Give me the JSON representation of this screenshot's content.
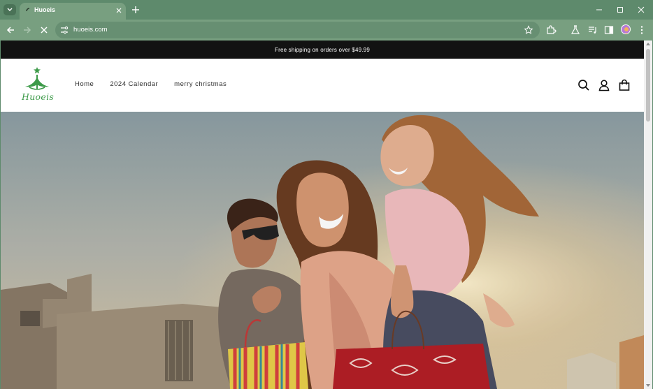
{
  "browser": {
    "tab_title": "Huoeis",
    "url": "huoeis.com",
    "frame_color": "#5e8a6c",
    "toolbar_color": "#789f80"
  },
  "site": {
    "announcement": "Free shipping on orders over $49.99",
    "logo_text": "Huoeis",
    "brand_color": "#3d9a49",
    "nav": [
      "Home",
      "2024 Calendar",
      "merry christmas"
    ]
  },
  "icons": {
    "tab_list": "chevron-down-icon",
    "new_tab": "plus-icon",
    "reload": "stop-loading-icon",
    "header": [
      "search-icon",
      "account-icon",
      "cart-bag-icon"
    ]
  }
}
